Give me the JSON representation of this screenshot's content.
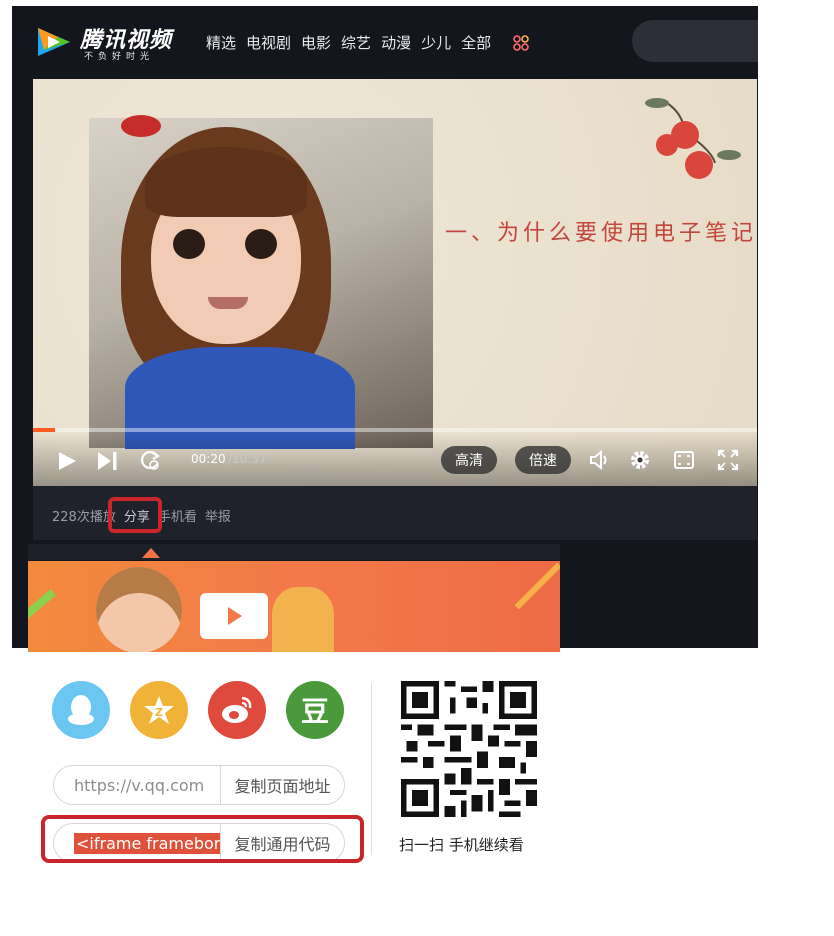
{
  "nav": {
    "logo_text": "腾讯视频",
    "logo_slogan": "不负好时光",
    "links": [
      "精选",
      "电视剧",
      "电影",
      "综艺",
      "动漫",
      "少儿",
      "全部"
    ]
  },
  "video": {
    "caption": "一、为什么要使用电子笔记",
    "time_current": "00:20",
    "time_total": "/10:57",
    "progress": 0.03,
    "quality_label": "高清",
    "speed_label": "倍速"
  },
  "info_bar": {
    "plays": "228次播放",
    "share": "分享",
    "mobile": "手机看",
    "report": "举报"
  },
  "share_panel": {
    "qzone_glyph": "Z",
    "douban_glyph": "豆",
    "url_value": "https://v.qq.com",
    "copy_url_label": "复制页面地址",
    "embed_value": "<iframe frameborder",
    "copy_embed_label": "复制通用代码",
    "qr_caption": "扫一扫 手机继续看"
  },
  "colors": {
    "accent": "#ff5a1f",
    "highlight_box": "#c8262a",
    "qq": "#6cc6f2",
    "qzone": "#f1b238",
    "weibo": "#df4a3c",
    "douban": "#4a9a3c"
  }
}
